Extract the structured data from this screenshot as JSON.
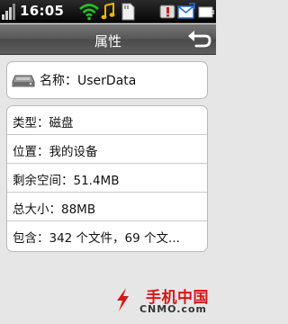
{
  "status_bar": {
    "time": "16:05",
    "icons": [
      "signal-icon",
      "wifi-icon",
      "music-note-icon",
      "sd-card-icon",
      "alert-icon",
      "message-icon",
      "battery-icon"
    ]
  },
  "title_bar": {
    "title": "属性",
    "back_icon": "back-arrow-icon"
  },
  "name_panel": {
    "icon": "hard-drive-icon",
    "name": "名称：UserData"
  },
  "info": {
    "items": [
      {
        "text": "类型：磁盘"
      },
      {
        "text": "位置：我的设备"
      },
      {
        "text": "剩余空间：51.4MB"
      },
      {
        "text": "总大小：88MB"
      },
      {
        "text": "包含：342 个文件，69 个文..."
      }
    ]
  },
  "watermark": {
    "cn": "手机中国",
    "en": "CNMO.com"
  },
  "colors": {
    "status_bar": "#050505",
    "title_bar": "#5a5a5a",
    "panel_bg": "#ffffff",
    "background": "#e6e6e6",
    "wifi": "#22c422",
    "music": "#e8b600",
    "watermark_red": "#d31818"
  }
}
